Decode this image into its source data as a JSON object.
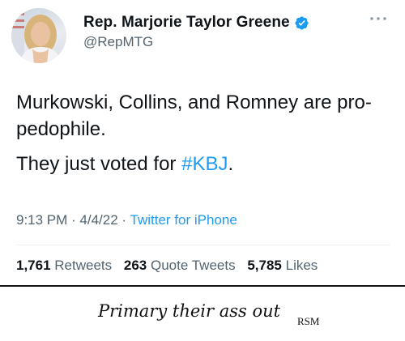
{
  "author": {
    "display_name": "Rep. Marjorie Taylor Greene",
    "handle": "@RepMTG"
  },
  "tweet": {
    "line1": "Murkowski, Collins, and Romney are pro-pedophile.",
    "line2_prefix": "They just voted for ",
    "hashtag": "#KBJ",
    "line2_suffix": "."
  },
  "meta": {
    "time": "9:13 PM",
    "sep1": " · ",
    "date": "4/4/22",
    "sep2": " · ",
    "source": "Twitter for iPhone"
  },
  "stats": {
    "retweets_count": "1,761",
    "retweets_label": "Retweets",
    "quotes_count": "263",
    "quotes_label": "Quote Tweets",
    "likes_count": "5,785",
    "likes_label": "Likes"
  },
  "annotation": {
    "caption": "Primary their ass out",
    "initials": "RSM"
  },
  "colors": {
    "accent": "#1d9bf0",
    "secondary_text": "#536471",
    "primary_text": "#0f1419"
  },
  "icons": [
    "avatar-photo",
    "verified-badge-icon",
    "more-options-icon"
  ]
}
